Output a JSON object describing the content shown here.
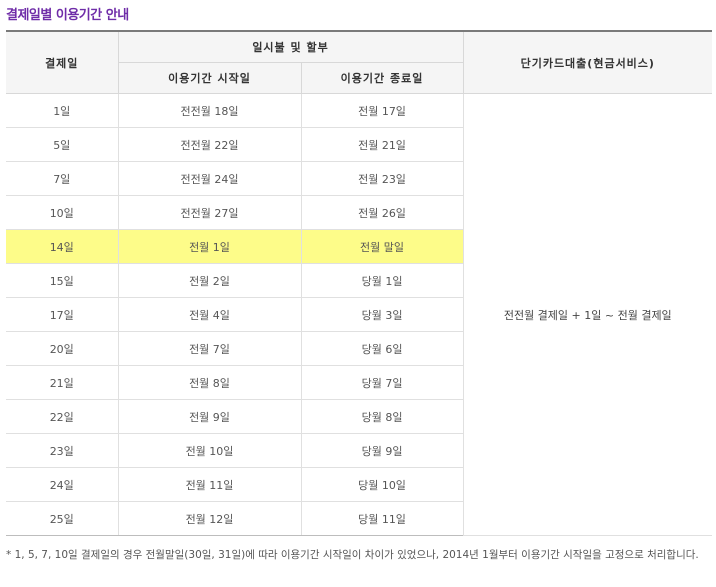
{
  "title": "결제일별 이용기간 안내",
  "table": {
    "headers": {
      "col1": "결제일",
      "group": "일시불 및 할부",
      "start": "이용기간 시작일",
      "end": "이용기간 종료일",
      "col4": "단기카드대출(현금서비스)"
    },
    "short_term_value": "전전월 결제일 + 1일 ~ 전월 결제일",
    "highlight_color": "#fdfc89",
    "rows": [
      {
        "day": "1일",
        "start": "전전월 18일",
        "end": "전월 17일"
      },
      {
        "day": "5일",
        "start": "전전월 22일",
        "end": "전월 21일"
      },
      {
        "day": "7일",
        "start": "전전월 24일",
        "end": "전월 23일"
      },
      {
        "day": "10일",
        "start": "전전월 27일",
        "end": "전월 26일"
      },
      {
        "day": "14일",
        "start": "전월 1일",
        "end": "전월 말일",
        "highlighted": true
      },
      {
        "day": "15일",
        "start": "전월 2일",
        "end": "당월 1일"
      },
      {
        "day": "17일",
        "start": "전월 4일",
        "end": "당월 3일"
      },
      {
        "day": "20일",
        "start": "전월 7일",
        "end": "당월 6일"
      },
      {
        "day": "21일",
        "start": "전월 8일",
        "end": "당월 7일"
      },
      {
        "day": "22일",
        "start": "전월 9일",
        "end": "당월 8일"
      },
      {
        "day": "23일",
        "start": "전월 10일",
        "end": "당월 9일"
      },
      {
        "day": "24일",
        "start": "전월 11일",
        "end": "당월 10일"
      },
      {
        "day": "25일",
        "start": "전월 12일",
        "end": "당월 11일"
      }
    ]
  },
  "note": "* 1, 5, 7, 10일 결제일의 경우 전월말일(30일, 31일)에 따라 이용기간 시작일이 차이가 있었으나, 2014년 1월부터 이용기간 시작일을 고정으로 처리합니다.",
  "colors": {
    "title": "#6f2da8",
    "highlight": "#fdfc89"
  }
}
